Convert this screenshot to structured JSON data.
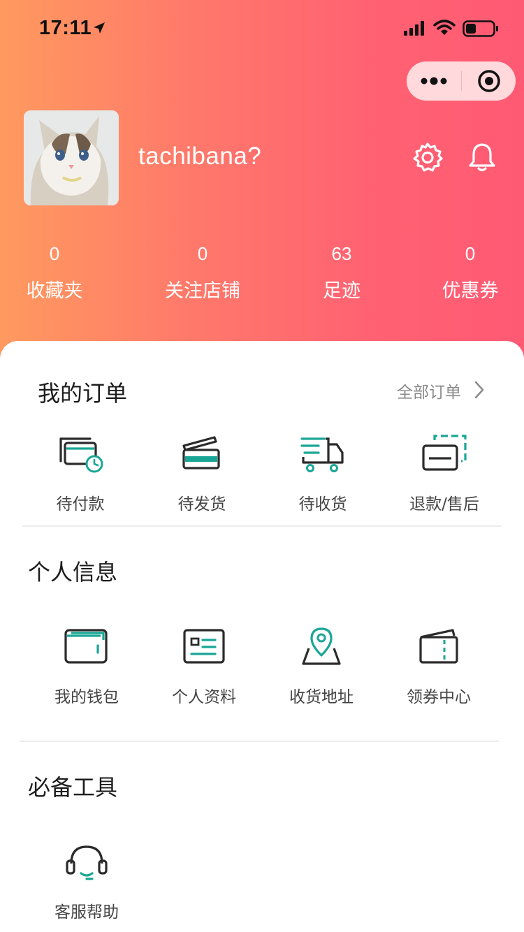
{
  "status_bar": {
    "time": "17:11"
  },
  "profile": {
    "username": "tachibana?"
  },
  "stats": [
    {
      "value": "0",
      "label": "收藏夹"
    },
    {
      "value": "0",
      "label": "关注店铺"
    },
    {
      "value": "63",
      "label": "足迹"
    },
    {
      "value": "0",
      "label": "优惠券"
    }
  ],
  "orders": {
    "title": "我的订单",
    "all_link": "全部订单",
    "items": [
      {
        "label": "待付款",
        "icon": "wallet-clock-icon"
      },
      {
        "label": "待发货",
        "icon": "box-icon"
      },
      {
        "label": "待收货",
        "icon": "truck-icon"
      },
      {
        "label": "退款/售后",
        "icon": "refund-card-icon"
      }
    ]
  },
  "personal": {
    "title": "个人信息",
    "items": [
      {
        "label": "我的钱包",
        "icon": "wallet-icon"
      },
      {
        "label": "个人资料",
        "icon": "profile-card-icon"
      },
      {
        "label": "收货地址",
        "icon": "map-pin-icon"
      },
      {
        "label": "领券中心",
        "icon": "coupon-icon"
      }
    ]
  },
  "tools": {
    "title": "必备工具",
    "items": [
      {
        "label": "客服帮助",
        "icon": "headset-icon"
      }
    ]
  },
  "colors": {
    "gradient_start": "#ff9a5f",
    "gradient_end": "#ff5a74",
    "icon_dark": "#2b2b2b",
    "icon_accent": "#1aa696"
  }
}
